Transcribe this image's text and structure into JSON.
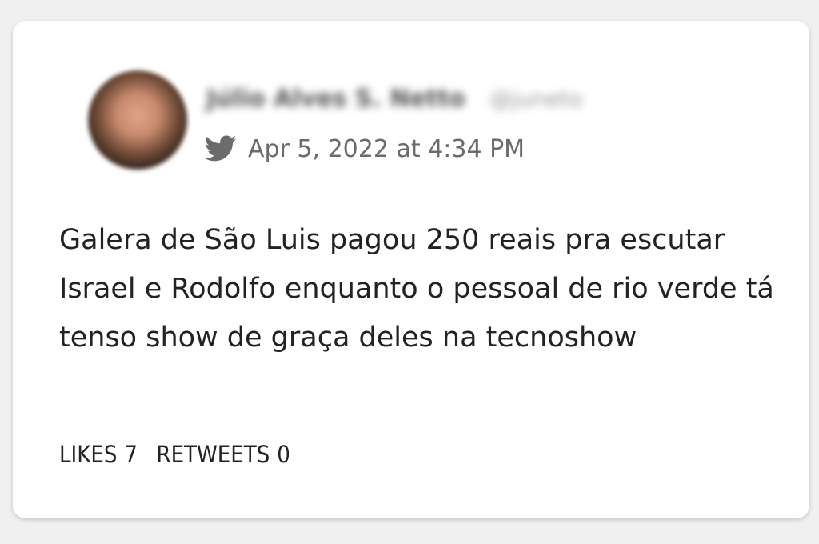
{
  "tweet": {
    "author_name": "Júlio Alves S. Netto",
    "author_handle": "@juneto",
    "date": "Apr 5, 2022 at 4:34 PM",
    "text": "Galera de São Luis pagou 250 reais pra escutar Israel e Rodolfo enquanto o pessoal de rio verde tá tenso show de graça deles na tecnoshow",
    "likes_label": "LIKES",
    "likes_count": "7",
    "retweets_label": "RETWEETS",
    "retweets_count": "0"
  },
  "icons": {
    "platform": "twitter-bird-icon"
  },
  "colors": {
    "background": "#f0f0f0",
    "card": "#ffffff",
    "text": "#222222",
    "meta_text": "#6b6b6b"
  }
}
